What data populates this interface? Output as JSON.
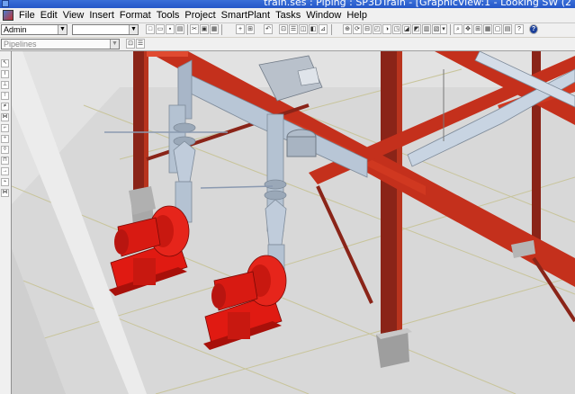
{
  "window": {
    "title": "train.ses : Piping : SP3DTrain - [GraphicView:1 - Looking SW (2"
  },
  "menu": {
    "items": [
      "File",
      "Edit",
      "View",
      "Insert",
      "Format",
      "Tools",
      "Project",
      "SmartPlant",
      "Tasks",
      "Window",
      "Help"
    ]
  },
  "toolbar": {
    "permission_group": "Admin",
    "style_value": "",
    "pipeline_filter": "Pipelines"
  },
  "icons": {
    "standard_toolbar": [
      "new-icon",
      "open-icon",
      "save-icon",
      "print-icon",
      "cut-icon",
      "copy-icon",
      "paste-icon",
      "delete-icon",
      "undo-icon",
      "select-icon",
      "filter-icon",
      "properties-icon",
      "measure-icon",
      "display-icon",
      "pan-icon",
      "zoom-icon",
      "rotate-icon",
      "fit-icon",
      "view-icon",
      "shading-icon",
      "dropdown-icon",
      "zoom-area-icon",
      "common-view-icon",
      "clip-icon",
      "named-view-icon",
      "refresh-icon",
      "help-icon"
    ],
    "left_toolbar": [
      "select-tool-icon",
      "route-pipe-icon",
      "insert-component-icon",
      "insert-tap-icon",
      "insert-spec-break-icon",
      "place-valve-icon",
      "connect-icon",
      "split-icon",
      "feature-icon",
      "support-icon",
      "flow-icon",
      "break-icon",
      "merge-icon"
    ]
  },
  "scene": {
    "background": "#e4e4e4",
    "floor": "#dcdcdc",
    "steel_color": "#c4301c",
    "column_color": "#8a2418",
    "pipe_color": "#b8c6d6",
    "pump_color": "#e01a12",
    "grid_line": "#c4c49a"
  }
}
